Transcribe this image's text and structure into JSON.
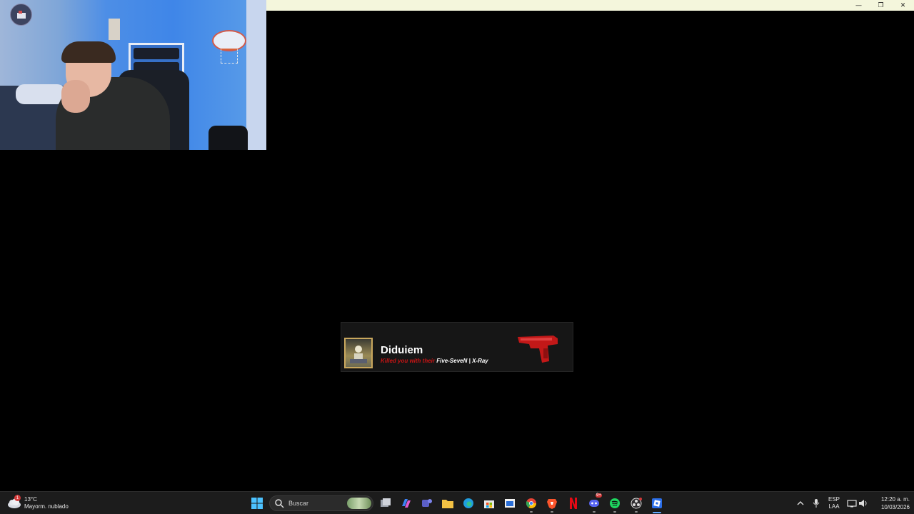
{
  "window": {
    "controls": [
      "—",
      "❐",
      "✕"
    ]
  },
  "webcam": {
    "logo_icon": "channel-logo-icon"
  },
  "kill_notification": {
    "killer_name": "Diduiem",
    "killed_text": "Killed you with their",
    "weapon_name": "Five-SeveN | X-Ray",
    "weapon_icon": "red-pistol-icon",
    "colors": {
      "accent_red": "#c81414",
      "avatar_border": "#c9a75d"
    }
  },
  "taskbar": {
    "weather": {
      "temperature": "13°C",
      "condition": "Mayorm. nublado",
      "badge": "1"
    },
    "search_placeholder": "Buscar",
    "apps": [
      "windows-start-icon",
      "task-view-icon",
      "copilot-icon",
      "teams-icon",
      "file-explorer-icon",
      "edge-icon",
      "microsoft-store-icon",
      "app-window-icon",
      "chrome-icon",
      "brave-icon",
      "netflix-icon",
      "discord-icon",
      "spotify-icon",
      "obs-icon",
      "roblox-icon"
    ],
    "discord_badge": "9+",
    "tray": {
      "language_line1": "ESP",
      "language_line2": "LAA",
      "time": "12:20 a. m.",
      "date": "10/03/2026"
    }
  }
}
